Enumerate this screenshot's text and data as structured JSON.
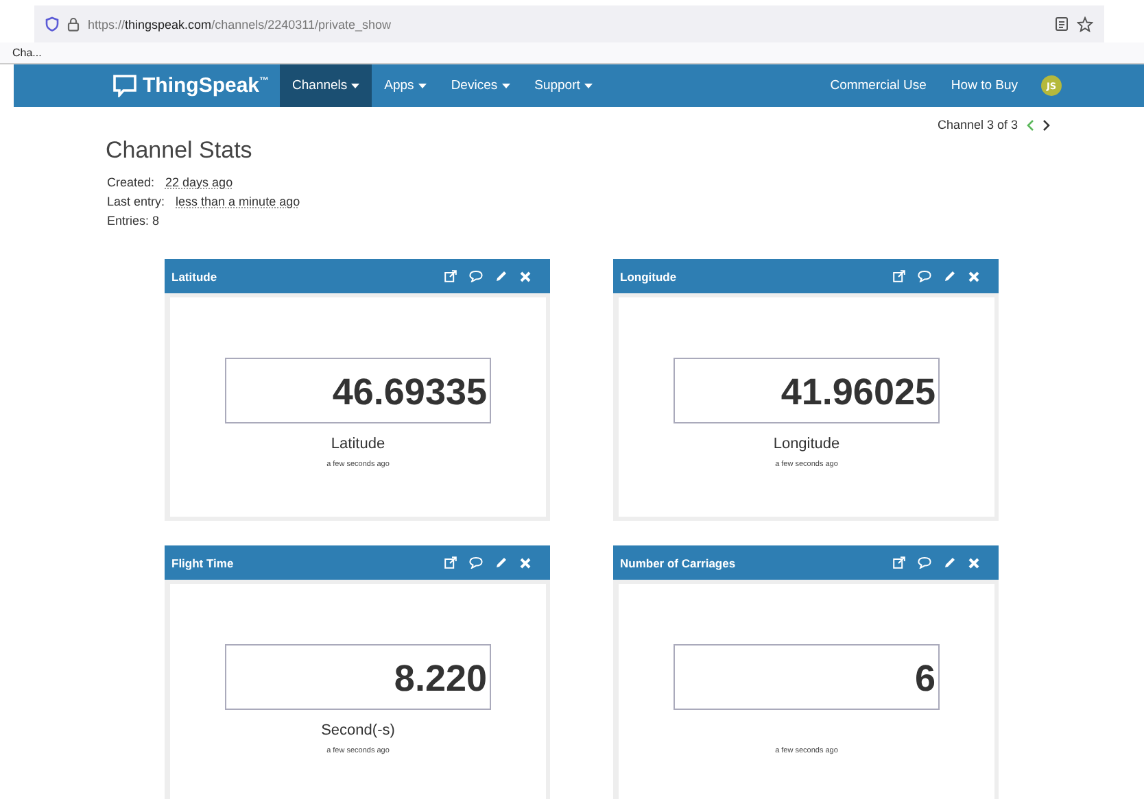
{
  "browser": {
    "url": "https://**thingspeak.com**/channels/2240311/private_show",
    "tab_title": "Cha..."
  },
  "navbar": {
    "brand": "ThingSpeak",
    "trademark": "™",
    "items": [
      {
        "label": "Channels",
        "selected": true,
        "dropdown": true
      },
      {
        "label": "Apps",
        "selected": false,
        "dropdown": true
      },
      {
        "label": "Devices",
        "selected": false,
        "dropdown": true
      },
      {
        "label": "Support",
        "selected": false,
        "dropdown": true
      }
    ],
    "right_items": [
      "Commercial Use",
      "How to Buy"
    ],
    "avatar": "JS"
  },
  "pager": {
    "label": "Channel 3 of 3"
  },
  "stats": {
    "title": "Channel Stats",
    "rows": [
      {
        "label": "Created:",
        "value": "22 days ago"
      },
      {
        "label": "Last entry:",
        "value": "less than a minute ago"
      },
      {
        "label": "Entries: 8"
      }
    ]
  },
  "widgets": [
    {
      "title": "Latitude",
      "value": "46.69335",
      "unit": "Latitude",
      "time": "a few seconds ago"
    },
    {
      "title": "Longitude",
      "value": "41.96025",
      "unit": "Longitude",
      "time": "a few seconds ago"
    },
    {
      "title": "Flight Time",
      "value": "8.220",
      "unit": "Second(-s)",
      "time": "a few seconds ago"
    },
    {
      "title": "Number of Carriages",
      "value": "6",
      "time": "a few seconds ago"
    }
  ]
}
